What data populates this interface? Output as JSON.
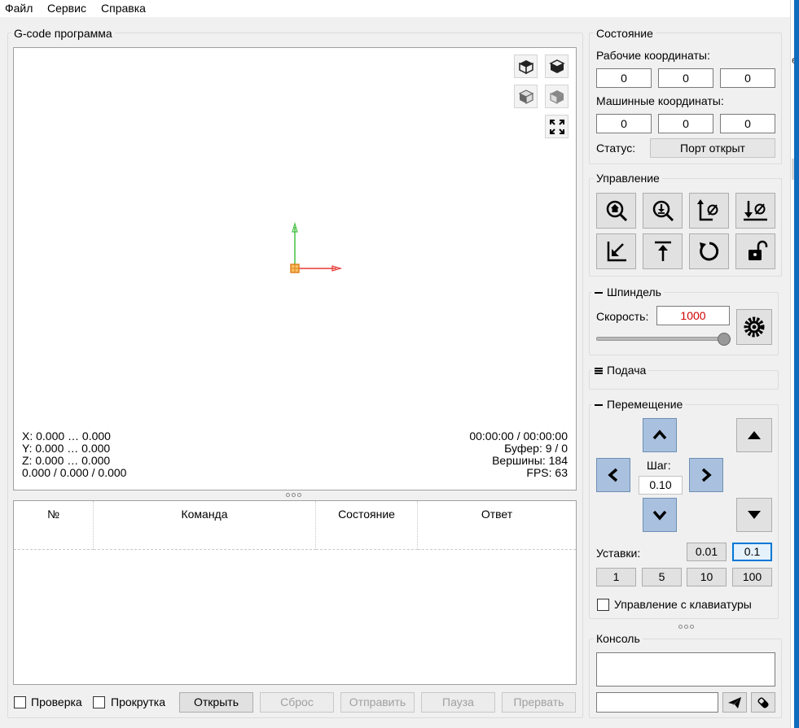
{
  "menu": {
    "items": [
      "Файл",
      "Сервис",
      "Справка"
    ]
  },
  "background_window": {
    "letter": "е"
  },
  "program": {
    "title": "G-code программа",
    "readout_left": [
      "X: 0.000 … 0.000",
      "Y: 0.000 … 0.000",
      "Z: 0.000 … 0.000",
      "0.000 / 0.000 / 0.000"
    ],
    "readout_right": [
      "00:00:00 / 00:00:00",
      "Буфер: 9 / 0",
      "Вершины: 184",
      "FPS: 63"
    ],
    "table_headers": [
      "№",
      "Команда",
      "Состояние",
      "Ответ"
    ],
    "check_label": "Проверка",
    "scroll_label": "Прокрутка",
    "buttons": {
      "open": "Открыть",
      "reset": "Сброс",
      "send": "Отправить",
      "pause": "Пауза",
      "abort": "Прервать"
    }
  },
  "state": {
    "title": "Состояние",
    "work_label": "Рабочие координаты:",
    "work_coords": [
      "0",
      "0",
      "0"
    ],
    "machine_label": "Машинные координаты:",
    "machine_coords": [
      "0",
      "0",
      "0"
    ],
    "status_label": "Статус:",
    "status_value": "Порт открыт"
  },
  "control": {
    "title": "Управление",
    "icons": [
      "home-search-icon",
      "probe-search-icon",
      "zero-xy-icon",
      "zero-z-icon",
      "return-to-zero-icon",
      "safe-position-icon",
      "restart-icon",
      "unlock-icon"
    ]
  },
  "spindle": {
    "title": "Шпиндель",
    "speed_label": "Скорость:",
    "speed_value": "1000",
    "speed_color": "#d00000",
    "slider_level": 1.0
  },
  "feed": {
    "title": "Подача"
  },
  "jog": {
    "title": "Перемещение",
    "step_label": "Шаг:",
    "step_value": "0.10",
    "presets_label": "Уставки:",
    "presets_row1": [
      "0.01",
      "0.1"
    ],
    "presets_row2": [
      "1",
      "5",
      "10",
      "100"
    ],
    "active_preset": "0.1",
    "keyboard_label": "Управление с клавиатуры"
  },
  "console": {
    "title": "Консоль"
  },
  "colors": {
    "accent": "#0078d7",
    "jog_blue": "#a9c1de",
    "axis_x": "#e53935",
    "axis_y": "#43c043",
    "origin": "#f0a020"
  }
}
